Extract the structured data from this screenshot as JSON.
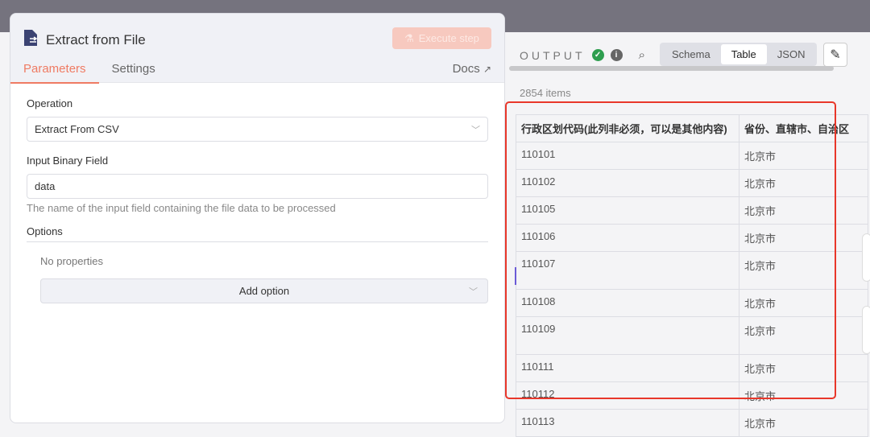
{
  "node": {
    "title": "Extract from File",
    "execute_label": "Execute step",
    "tabs": [
      "Parameters",
      "Settings"
    ],
    "docs_label": "Docs"
  },
  "params": {
    "operation_label": "Operation",
    "operation_value": "Extract From CSV",
    "binary_label": "Input Binary Field",
    "binary_value": "data",
    "binary_hint": "The name of the input field containing the file data to be processed",
    "options_label": "Options",
    "no_properties": "No properties",
    "add_option": "Add option"
  },
  "output": {
    "label": "OUTPUT",
    "views": [
      "Schema",
      "Table",
      "JSON"
    ],
    "active_view": "Table",
    "count": "2854 items",
    "columns": [
      "行政区划代码(此列非必须，可以是其他内容)",
      "省份、直辖市、自治区"
    ],
    "rows": [
      [
        "110101",
        "北京市"
      ],
      [
        "110102",
        "北京市"
      ],
      [
        "110105",
        "北京市"
      ],
      [
        "110106",
        "北京市"
      ],
      [
        "110107",
        "北京市"
      ],
      [
        "110108",
        "北京市"
      ],
      [
        "110109",
        "北京市"
      ],
      [
        "110111",
        "北京市"
      ],
      [
        "110112",
        "北京市"
      ],
      [
        "110113",
        "北京市"
      ]
    ]
  },
  "colors": {
    "accent": "#ef7b63",
    "highlight": "#e8372a",
    "success": "#2e9e4f"
  }
}
